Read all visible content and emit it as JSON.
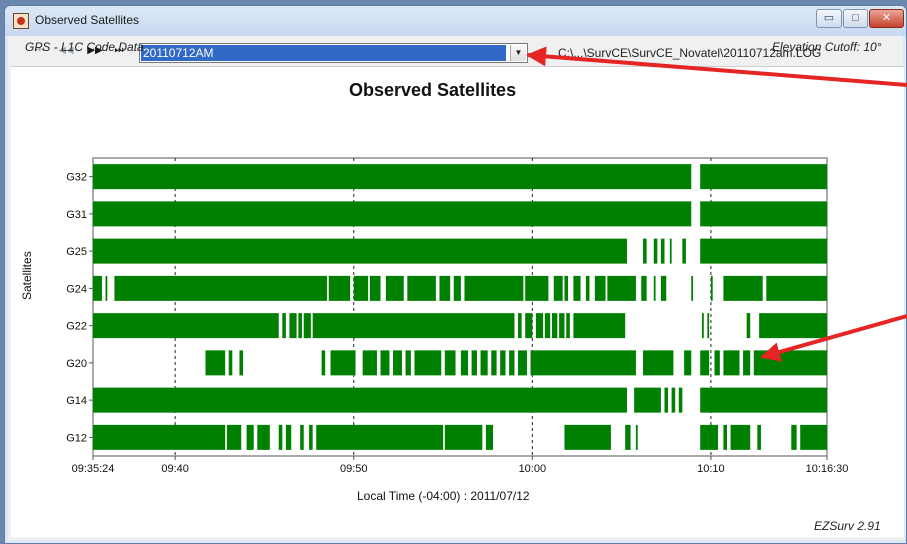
{
  "window": {
    "title": "Observed Satellites",
    "buttons": {
      "minimize": "▭",
      "maximize": "□",
      "close": "✕"
    }
  },
  "toolbar": {
    "nav_buttons": [
      "first",
      "previous",
      "next",
      "last"
    ],
    "nav_glyphs": [
      "⏮",
      "◀◀",
      "▶▶",
      "⏭"
    ],
    "session_value": "20110712AM",
    "file_path": "C:\\...\\SurvCE\\SurvCE_Novatel\\20110712am.LOG"
  },
  "header": {
    "code_data": "GPS - L1C Code Data",
    "cutoff": "Elevation Cutoff: 10°"
  },
  "footer": {
    "version": "EZSurv 2.91"
  },
  "colors": {
    "bar": "#008000",
    "arrow": "#e52424",
    "grid_dash": "#222222"
  },
  "chart_data": {
    "type": "bar",
    "title": "Observed Satellites",
    "ylabel": "Satellites",
    "xlabel": "Local Time (-04:00) : 2011/07/12",
    "xlim": [
      "09:35:24",
      "10:16:30"
    ],
    "x_ticks": [
      "09:35:24",
      "09:40",
      "09:50",
      "10:00",
      "10:10",
      "10:16:30"
    ],
    "x_tick_minutes": [
      0,
      4.6,
      14.6,
      24.6,
      34.6,
      41.1
    ],
    "satellites": [
      "G32",
      "G31",
      "G25",
      "G24",
      "G22",
      "G20",
      "G14",
      "G12"
    ],
    "tracking_segments_minutes": [
      [
        [
          0,
          33.5
        ],
        [
          34.0,
          41.1
        ]
      ],
      [
        [
          0,
          33.5
        ],
        [
          34.0,
          41.1
        ]
      ],
      [
        [
          0,
          29.9
        ],
        [
          30.8,
          31.0
        ],
        [
          31.4,
          31.6
        ],
        [
          31.8,
          32.0
        ],
        [
          32.3,
          32.4
        ],
        [
          33.0,
          33.2
        ],
        [
          34.0,
          41.1
        ]
      ],
      [
        [
          0,
          0.5
        ],
        [
          0.7,
          0.8
        ],
        [
          1.2,
          13.1
        ],
        [
          13.2,
          14.4
        ],
        [
          14.6,
          15.4
        ],
        [
          15.5,
          16.1
        ],
        [
          16.4,
          17.4
        ],
        [
          17.6,
          19.2
        ],
        [
          19.4,
          20.0
        ],
        [
          20.2,
          20.6
        ],
        [
          20.8,
          24.1
        ],
        [
          24.2,
          25.5
        ],
        [
          25.8,
          26.3
        ],
        [
          26.4,
          26.6
        ],
        [
          26.9,
          27.3
        ],
        [
          27.6,
          27.8
        ],
        [
          28.1,
          28.7
        ],
        [
          28.8,
          30.4
        ],
        [
          30.7,
          31.0
        ],
        [
          31.4,
          31.5
        ],
        [
          31.8,
          32.1
        ],
        [
          33.5,
          33.6
        ],
        [
          34.6,
          34.7
        ],
        [
          35.3,
          37.5
        ],
        [
          37.7,
          41.1
        ]
      ],
      [
        [
          0,
          10.4
        ],
        [
          10.6,
          10.8
        ],
        [
          11.0,
          11.4
        ],
        [
          11.5,
          11.7
        ],
        [
          11.8,
          12.2
        ],
        [
          12.3,
          23.6
        ],
        [
          23.8,
          24.0
        ],
        [
          24.2,
          24.6
        ],
        [
          24.8,
          25.2
        ],
        [
          25.3,
          25.6
        ],
        [
          25.7,
          26.0
        ],
        [
          26.1,
          26.4
        ],
        [
          26.5,
          26.7
        ],
        [
          26.9,
          29.8
        ],
        [
          34.1,
          34.2
        ],
        [
          34.4,
          34.5
        ],
        [
          36.6,
          36.8
        ],
        [
          37.3,
          41.1
        ]
      ],
      [
        [
          6.3,
          7.4
        ],
        [
          7.6,
          7.8
        ],
        [
          8.2,
          8.4
        ],
        [
          12.8,
          13.0
        ],
        [
          13.3,
          14.7
        ],
        [
          15.1,
          15.9
        ],
        [
          16.1,
          16.6
        ],
        [
          16.8,
          17.3
        ],
        [
          17.5,
          17.8
        ],
        [
          18.0,
          19.5
        ],
        [
          19.7,
          20.3
        ],
        [
          20.6,
          21.0
        ],
        [
          21.2,
          21.5
        ],
        [
          21.7,
          22.1
        ],
        [
          22.3,
          22.6
        ],
        [
          22.8,
          23.1
        ],
        [
          23.3,
          23.6
        ],
        [
          23.8,
          24.3
        ],
        [
          24.5,
          30.4
        ],
        [
          30.8,
          32.5
        ],
        [
          33.1,
          33.5
        ],
        [
          34.0,
          34.5
        ],
        [
          34.8,
          35.1
        ],
        [
          35.3,
          36.2
        ],
        [
          36.4,
          36.8
        ],
        [
          37.0,
          41.1
        ]
      ],
      [
        [
          0,
          29.9
        ],
        [
          30.3,
          31.8
        ],
        [
          32.0,
          32.2
        ],
        [
          32.4,
          32.6
        ],
        [
          32.8,
          33.0
        ],
        [
          34.0,
          41.1
        ]
      ],
      [
        [
          0,
          7.4
        ],
        [
          7.5,
          8.3
        ],
        [
          8.6,
          9.0
        ],
        [
          9.2,
          9.9
        ],
        [
          10.4,
          10.6
        ],
        [
          10.8,
          11.1
        ],
        [
          11.6,
          11.8
        ],
        [
          12.1,
          12.3
        ],
        [
          12.5,
          19.6
        ],
        [
          19.7,
          21.8
        ],
        [
          22.0,
          22.4
        ],
        [
          26.4,
          29.0
        ],
        [
          29.8,
          30.1
        ],
        [
          30.4,
          30.5
        ],
        [
          34.0,
          35.0
        ],
        [
          35.3,
          35.5
        ],
        [
          35.7,
          36.8
        ],
        [
          37.2,
          37.4
        ],
        [
          39.1,
          39.4
        ],
        [
          39.6,
          41.1
        ]
      ]
    ]
  }
}
